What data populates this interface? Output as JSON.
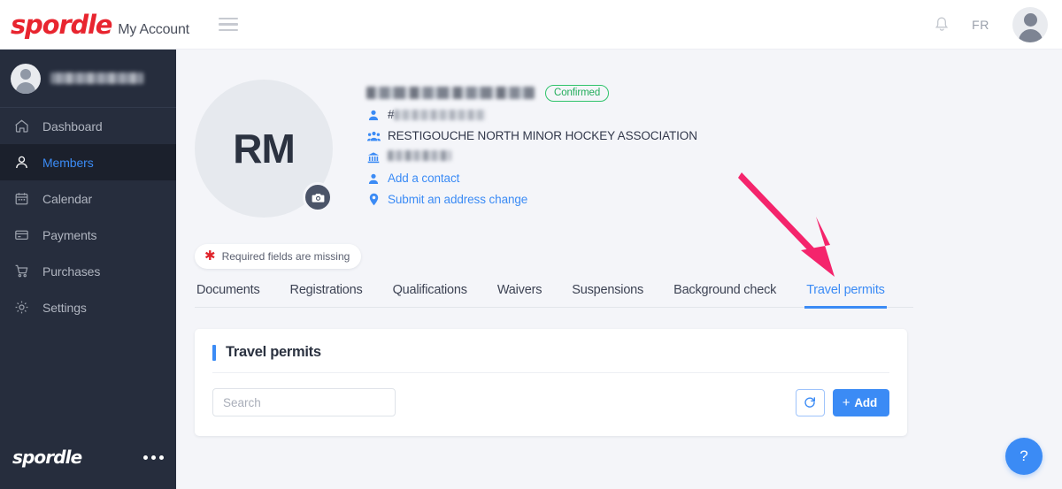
{
  "topbar": {
    "brand": "spordle",
    "brand_sub": "My Account",
    "menu_icon": "hamburger-icon",
    "notification_icon": "bell-icon",
    "language": "FR",
    "avatar_icon": "user-avatar"
  },
  "sidebar": {
    "user_name_redacted": "",
    "items": [
      {
        "label": "Dashboard",
        "icon": "home-icon",
        "active": false
      },
      {
        "label": "Members",
        "icon": "user-icon",
        "active": true
      },
      {
        "label": "Calendar",
        "icon": "calendar-icon",
        "active": false
      },
      {
        "label": "Payments",
        "icon": "credit-card-icon",
        "active": false
      },
      {
        "label": "Purchases",
        "icon": "shopping-cart-icon",
        "active": false
      },
      {
        "label": "Settings",
        "icon": "gear-icon",
        "active": false
      }
    ],
    "footer_logo": "spordle",
    "footer_menu_icon": "ellipsis-icon"
  },
  "profile": {
    "initials": "RM",
    "camera_icon": "camera-icon",
    "name_redacted": "",
    "status_badge": "Confirmed",
    "member_number_prefix": "#",
    "member_number_redacted": "",
    "organization": "RESTIGOUCHE NORTH MINOR HOCKEY ASSOCIATION",
    "address_redacted": "",
    "add_contact_label": "Add a contact",
    "address_change_label": "Submit an address change",
    "icons": {
      "member": "person-icon",
      "organization": "people-group-icon",
      "address": "institution-icon",
      "add_contact": "person-add-icon",
      "address_change": "location-pin-icon"
    }
  },
  "alert": {
    "text": "Required fields are missing",
    "icon": "asterisk-icon"
  },
  "tabs": [
    {
      "label": "Documents",
      "active": false
    },
    {
      "label": "Registrations",
      "active": false
    },
    {
      "label": "Qualifications",
      "active": false
    },
    {
      "label": "Waivers",
      "active": false
    },
    {
      "label": "Suspensions",
      "active": false
    },
    {
      "label": "Background check",
      "active": false
    },
    {
      "label": "Travel permits",
      "active": true
    }
  ],
  "card": {
    "title": "Travel permits",
    "search_placeholder": "Search",
    "search_value": "",
    "refresh_icon": "refresh-icon",
    "add_label": "Add",
    "add_plus": "+"
  },
  "help": {
    "label": "?"
  },
  "annotation": {
    "type": "arrow",
    "color": "#f4246c",
    "points_to": "Travel permits"
  },
  "colors": {
    "accent_blue": "#3b8bf5",
    "sidebar_bg": "#262d3d",
    "page_bg": "#f4f5f9",
    "brand_red": "#e8252f",
    "status_green": "#24ad5c",
    "alert_red": "#e0242b",
    "annotation_pink": "#f4246c"
  }
}
